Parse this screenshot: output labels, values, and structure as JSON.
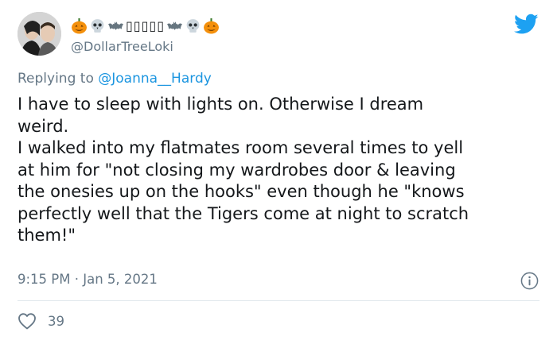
{
  "tweet": {
    "display_name": "▯▯▯▯▯",
    "display_emojis_left": [
      "pumpkin-icon",
      "skull-icon",
      "bat-icon"
    ],
    "display_emojis_right": [
      "bat-icon",
      "skull-icon",
      "pumpkin-icon"
    ],
    "handle": "@DollarTreeLoki",
    "replying_prefix": "Replying to ",
    "replying_to": "@Joanna__Hardy",
    "text": "I have to sleep with lights on. Otherwise I dream\nweird.\nI walked into my flatmates room several times to yell\nat him for \"not closing my wardrobes door & leaving\nthe onesies up on the hooks\" even though he \"knows\nperfectly well that the Tigers come at night to scratch\nthem!\"",
    "timestamp": "9:15 PM · Jan 5, 2021",
    "likes": "39"
  },
  "colors": {
    "accent": "#1da1f2",
    "link": "#1b95e0",
    "secondary_text": "#657786",
    "divider": "#e1e8ed"
  }
}
